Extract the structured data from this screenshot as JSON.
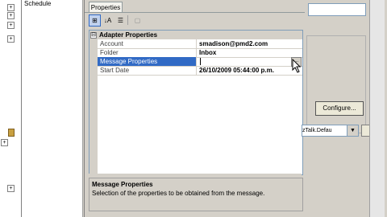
{
  "tree": {
    "expanders": [
      "+",
      "+",
      "+",
      "+",
      "+",
      "+"
    ]
  },
  "left_panel": {
    "schedule_label": "Schedule"
  },
  "properties_window": {
    "tab_label": "Properties",
    "toolbar": {
      "categorized": "⊞",
      "alphabetical": "↓A",
      "properties": "☰",
      "property_pages": "▢"
    },
    "category": {
      "toggle": "⊟",
      "label": "Adapter Properties"
    },
    "rows": [
      {
        "name": "Account",
        "value": "smadison@pmd2.com"
      },
      {
        "name": "Folder",
        "value": "Inbox"
      },
      {
        "name": "Message Properties",
        "value": ""
      },
      {
        "name": "Start Date",
        "value": "26/10/2009 05:44:00 p.m."
      }
    ],
    "ellipsis_label": "...",
    "description": {
      "title": "Message Properties",
      "text": "Selection of the properties to be obtained from the message."
    }
  },
  "host": {
    "configure_label": "Configure...",
    "combo_value": "zTalk.Defau",
    "combo_arrow": "▼"
  },
  "colors": {
    "selection": "#316ac5",
    "chrome": "#d4d0c8"
  }
}
